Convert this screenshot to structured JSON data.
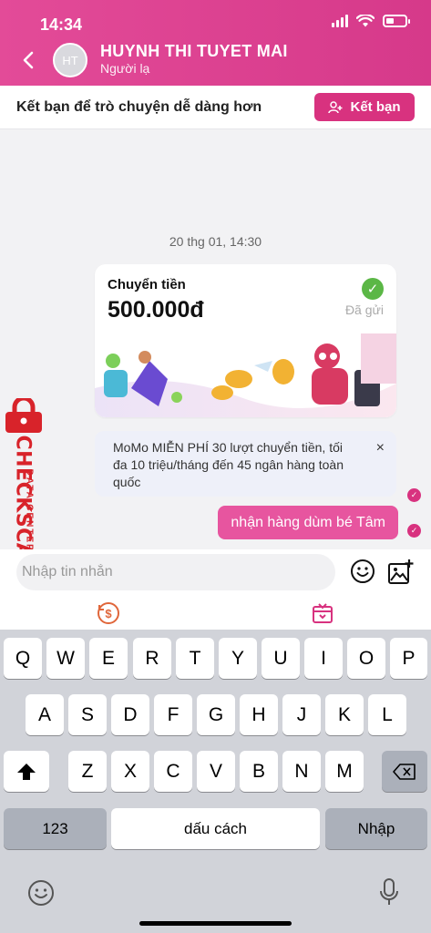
{
  "status_bar": {
    "time": "14:34"
  },
  "header": {
    "avatar_initials": "HT",
    "name": "HUYNH THI TUYET MAI",
    "subtitle": "Người lạ"
  },
  "friend_bar": {
    "prompt": "Kết bạn để trò chuyện dễ dàng hơn",
    "button_label": "Kết bạn"
  },
  "chat": {
    "date": "20 thg 01, 14:30",
    "transfer": {
      "title": "Chuyển tiền",
      "amount": "500.000đ",
      "status": "Đã gửi"
    },
    "promo": {
      "text": "MoMo MIỄN PHÍ 30 lượt chuyển tiền, tối đa 10 triệu/tháng đến 45 ngân hàng toàn quốc",
      "close": "×"
    },
    "message": "nhận hàng dùm bé Tâm"
  },
  "watermark": {
    "line1": "DATA CENTER",
    "line2": "CHECKSCAM.INFO"
  },
  "input": {
    "placeholder": "Nhập tin nhắn"
  },
  "keyboard": {
    "row1": [
      "Q",
      "W",
      "E",
      "R",
      "T",
      "Y",
      "U",
      "I",
      "O",
      "P"
    ],
    "row2": [
      "A",
      "S",
      "D",
      "F",
      "G",
      "H",
      "J",
      "K",
      "L"
    ],
    "row3": [
      "Z",
      "X",
      "C",
      "V",
      "B",
      "N",
      "M"
    ],
    "numbers_key": "123",
    "space_key": "dấu cách",
    "return_key": "Nhập"
  },
  "colors": {
    "brand": "#d8327f",
    "bubble": "#e7559f",
    "sent_check": "#5bb746",
    "watermark": "#d8232a"
  }
}
